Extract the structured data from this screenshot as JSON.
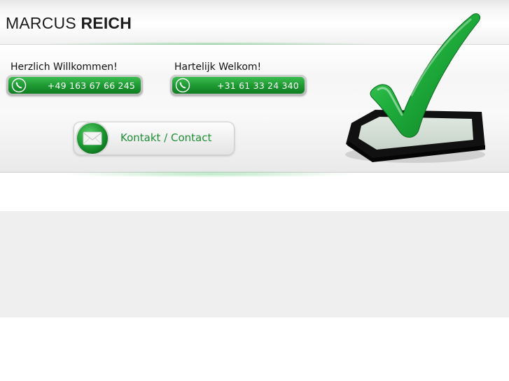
{
  "header": {
    "name_first": "MARCUS ",
    "name_last": "REICH"
  },
  "greetings": {
    "de": {
      "text": "Herzlich Willkommen!",
      "phone": "+49 163 67 66 245"
    },
    "nl": {
      "text": "Hartelijk Welkom!",
      "phone": "+31 61 33 24 340"
    }
  },
  "contact": {
    "label": "Kontakt / Contact"
  },
  "icons": {
    "phone": "phone-icon",
    "envelope": "envelope-icon",
    "checkmark": "checkmark-icon"
  },
  "colors": {
    "accent_green": "#1f9a33",
    "text_green": "#1f8f35",
    "band_gray": "#efefef"
  }
}
